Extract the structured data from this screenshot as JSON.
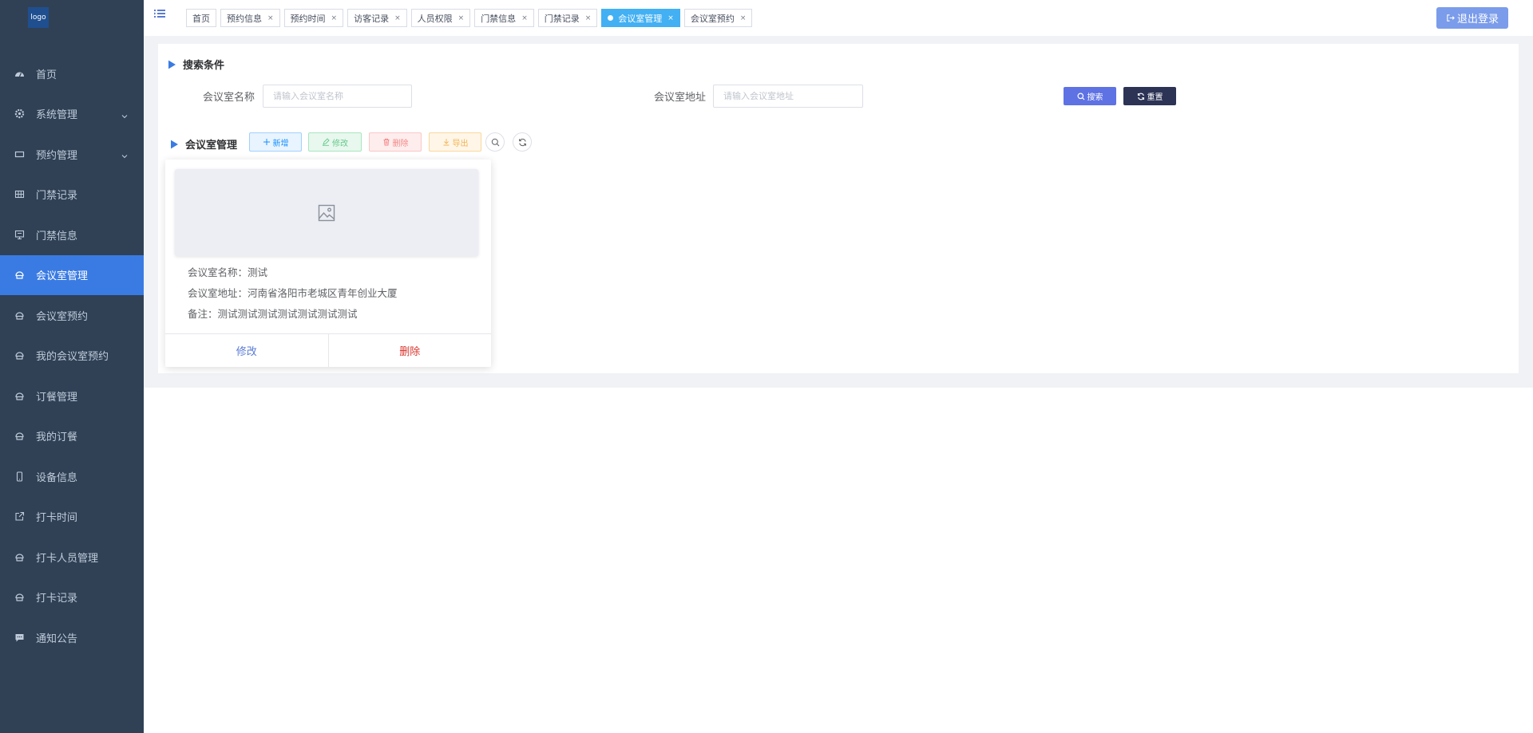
{
  "logo": {
    "text": "logo"
  },
  "sidebar": {
    "items": [
      {
        "label": "首页",
        "icon": "dashboard-icon",
        "active": false,
        "has_arrow": false
      },
      {
        "label": "系统管理",
        "icon": "gear-icon",
        "active": false,
        "has_arrow": true
      },
      {
        "label": "预约管理",
        "icon": "rectangle-icon",
        "active": false,
        "has_arrow": true
      },
      {
        "label": "门禁记录",
        "icon": "table-icon",
        "active": false,
        "has_arrow": false
      },
      {
        "label": "门禁信息",
        "icon": "monitor-icon",
        "active": false,
        "has_arrow": false
      },
      {
        "label": "会议室管理",
        "icon": "meeting-icon",
        "active": true,
        "has_arrow": false
      },
      {
        "label": "会议室预约",
        "icon": "meeting-icon",
        "active": false,
        "has_arrow": false
      },
      {
        "label": "我的会议室预约",
        "icon": "meeting-icon",
        "active": false,
        "has_arrow": false
      },
      {
        "label": "订餐管理",
        "icon": "meeting-icon",
        "active": false,
        "has_arrow": false
      },
      {
        "label": "我的订餐",
        "icon": "meeting-icon",
        "active": false,
        "has_arrow": false
      },
      {
        "label": "设备信息",
        "icon": "phone-icon",
        "active": false,
        "has_arrow": false
      },
      {
        "label": "打卡时间",
        "icon": "external-link-icon",
        "active": false,
        "has_arrow": false
      },
      {
        "label": "打卡人员管理",
        "icon": "meeting-icon",
        "active": false,
        "has_arrow": false
      },
      {
        "label": "打卡记录",
        "icon": "meeting-icon",
        "active": false,
        "has_arrow": false
      },
      {
        "label": "通知公告",
        "icon": "message-icon",
        "active": false,
        "has_arrow": false
      }
    ]
  },
  "tags": [
    {
      "label": "首页",
      "closable": false,
      "active": false
    },
    {
      "label": "预约信息",
      "closable": true,
      "active": false
    },
    {
      "label": "预约时间",
      "closable": true,
      "active": false
    },
    {
      "label": "访客记录",
      "closable": true,
      "active": false
    },
    {
      "label": "人员权限",
      "closable": true,
      "active": false
    },
    {
      "label": "门禁信息",
      "closable": true,
      "active": false
    },
    {
      "label": "门禁记录",
      "closable": true,
      "active": false
    },
    {
      "label": "会议室管理",
      "closable": true,
      "active": true
    },
    {
      "label": "会议室预约",
      "closable": true,
      "active": false
    }
  ],
  "tag_close_glyph": "×",
  "header": {
    "logout_label": "退出登录"
  },
  "search": {
    "title": "搜索条件",
    "name_label": "会议室名称",
    "name_placeholder": "请输入会议室名称",
    "name_value": "",
    "address_label": "会议室地址",
    "address_placeholder": "请输入会议室地址",
    "address_value": "",
    "search_button": "搜索",
    "reset_button": "重置"
  },
  "toolbar": {
    "title": "会议室管理",
    "add_label": "新增",
    "edit_label": "修改",
    "delete_label": "删除",
    "export_label": "导出"
  },
  "card": {
    "name_line": "会议室名称：测试",
    "address_line": "会议室地址：河南省洛阳市老城区青年创业大厦",
    "remark_line": "备注：测试测试测试测试测试测试测试",
    "edit_label": "修改",
    "delete_label": "删除"
  },
  "colors": {
    "sidebar_bg": "#304156",
    "active_menu": "#3a7be3",
    "active_tag": "#42b0f3",
    "search_button": "#5e72e4",
    "reset_button": "#2c3355",
    "delete_text": "#d9342b"
  }
}
